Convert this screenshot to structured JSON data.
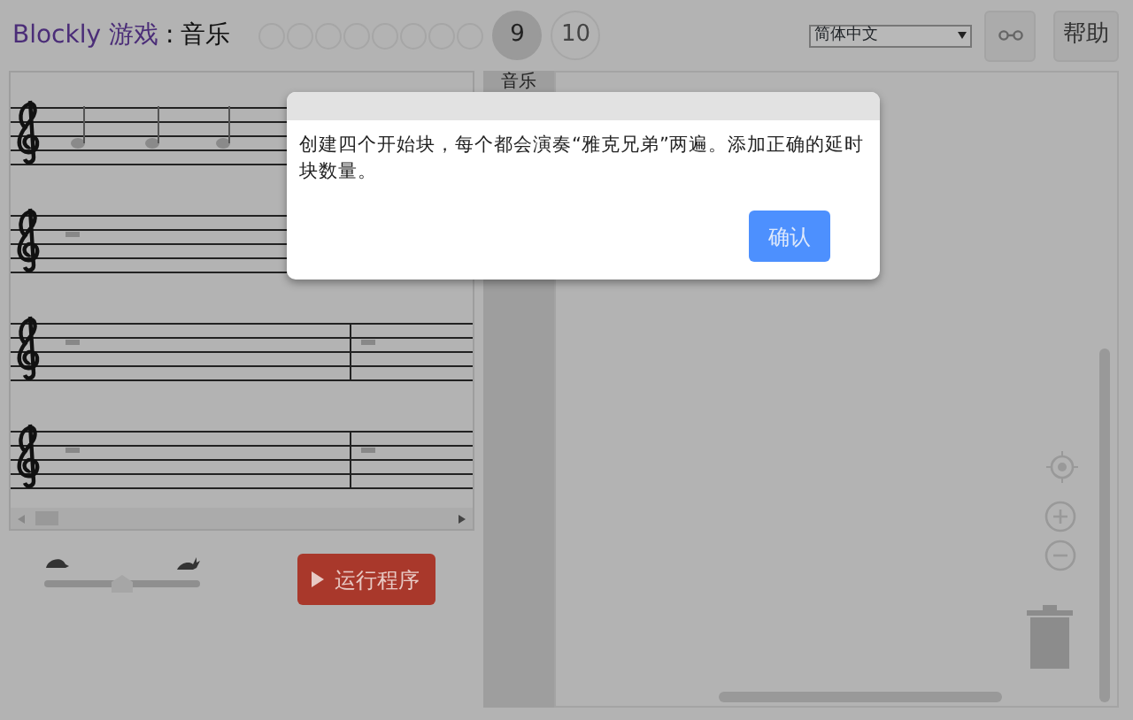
{
  "header": {
    "app": "Blockly 游戏",
    "separator": ":",
    "game": "音乐"
  },
  "levels": [
    {
      "kind": "dot",
      "selected": false
    },
    {
      "kind": "dot",
      "selected": false
    },
    {
      "kind": "dot",
      "selected": false
    },
    {
      "kind": "dot",
      "selected": false
    },
    {
      "kind": "dot",
      "selected": false
    },
    {
      "kind": "dot",
      "selected": false
    },
    {
      "kind": "dot",
      "selected": false
    },
    {
      "kind": "dot",
      "selected": false
    },
    {
      "kind": "number",
      "label": "9",
      "selected": true
    },
    {
      "kind": "number",
      "label": "10",
      "selected": false
    }
  ],
  "language": {
    "value": "简体中文"
  },
  "help_button": "帮助",
  "toolbox": {
    "categories": [
      {
        "label": "音乐"
      }
    ]
  },
  "speed": {
    "level": 0.5
  },
  "run_button": "运行程序",
  "dialog": {
    "message": "创建四个开始块，每个都会演奏“雅克兄弟”两遍。添加正确的延时块数量。",
    "button": "确认"
  }
}
